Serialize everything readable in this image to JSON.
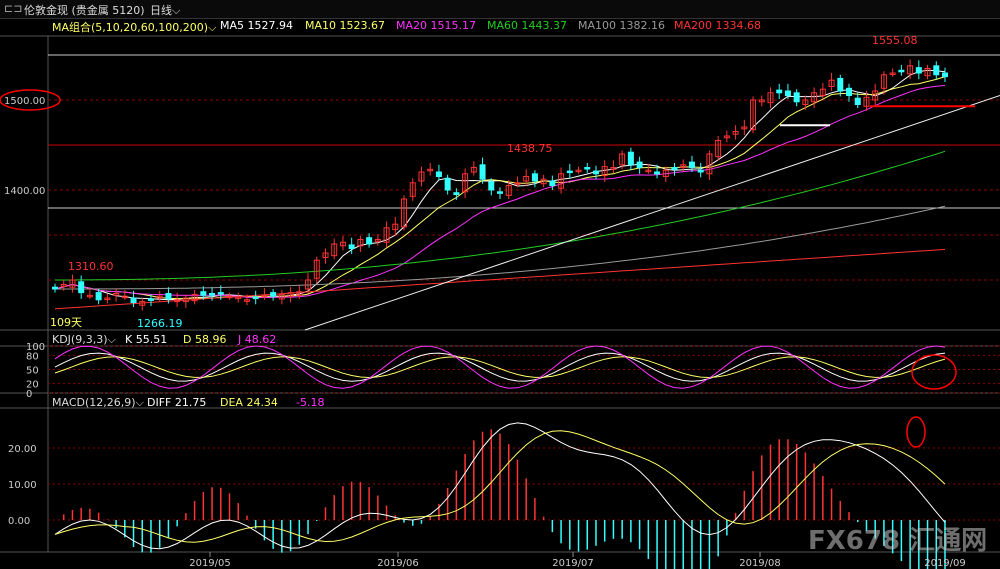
{
  "header": {
    "window_icon": "link-icon",
    "instrument": "伦敦金现 (贵金属 5120)",
    "period": "日线",
    "period_dropdown_icon": "chevron-down-icon"
  },
  "ma_legend": {
    "group": "MA组合(5,10,20,60,100,200)",
    "items": [
      {
        "label": "MA5 1527.94",
        "color": "#ffffff"
      },
      {
        "label": "MA10 1523.67",
        "color": "#ffff66"
      },
      {
        "label": "MA20 1515.17",
        "color": "#ff33ff"
      },
      {
        "label": "MA60 1443.37",
        "color": "#22cc22"
      },
      {
        "label": "MA100 1382.16",
        "color": "#999999"
      },
      {
        "label": "MA200 1334.68",
        "color": "#ff3333"
      }
    ]
  },
  "price_panel": {
    "y_ticks": [
      "1500.00",
      "1400.00"
    ],
    "annotations": {
      "high": "1555.08",
      "mid": "1438.75",
      "early_high": "1310.60",
      "low": "1266.19",
      "days": "109天"
    }
  },
  "kdj_legend": {
    "title": "KDJ(9,3,3)",
    "k": "K 55.51",
    "d": "D 58.96",
    "j": "J 48.62",
    "y_ticks": [
      "100",
      "80",
      "50",
      "20",
      "0"
    ]
  },
  "macd_legend": {
    "title": "MACD(12,26,9)",
    "diff": "DIFF 21.75",
    "dea": "DEA 24.34",
    "macd": "-5.18",
    "y_ticks": [
      "20.00",
      "10.00",
      "0.00"
    ]
  },
  "x_axis": {
    "labels": [
      "2019/05",
      "2019/06",
      "2019/07",
      "2019/08",
      "2019/09"
    ]
  },
  "watermark": "FX678 汇通网",
  "colors": {
    "up": "#ff3333",
    "down": "#33ffff",
    "ma5": "#ffffff",
    "ma10": "#ffff66",
    "ma20": "#ff33ff",
    "ma60": "#22cc22",
    "ma100": "#999999",
    "ma200": "#ff3333",
    "grid": "#8b0000",
    "highlight": "#ff0000"
  },
  "chart_data": [
    {
      "type": "candlestick",
      "x": [
        "2019/05",
        "2019/06",
        "2019/07",
        "2019/08",
        "2019/09"
      ],
      "y_ticks": [
        1400,
        1500
      ],
      "points_of_interest": {
        "high": 1555.08,
        "high_mid": 1438.75,
        "early_high": 1310.6,
        "low": 1266.19
      },
      "close_trend": [
        1290,
        1295,
        1300,
        1286,
        1283,
        1278,
        1280,
        1285,
        1282,
        1275,
        1276,
        1278,
        1282,
        1279,
        1278,
        1280,
        1284,
        1283,
        1283,
        1285,
        1282,
        1281,
        1278,
        1280,
        1283,
        1282,
        1284,
        1286,
        1287,
        1300,
        1322,
        1330,
        1340,
        1342,
        1335,
        1345,
        1340,
        1345,
        1358,
        1362,
        1390,
        1408,
        1420,
        1423,
        1415,
        1400,
        1395,
        1418,
        1425,
        1412,
        1400,
        1397,
        1405,
        1408,
        1415,
        1410,
        1412,
        1405,
        1418,
        1420,
        1422,
        1424,
        1418,
        1426,
        1425,
        1440,
        1428,
        1425,
        1422,
        1418,
        1422,
        1423,
        1428,
        1425,
        1420,
        1440,
        1455,
        1460,
        1465,
        1470,
        1500,
        1500,
        1508,
        1508,
        1505,
        1498,
        1500,
        1508,
        1512,
        1522,
        1510,
        1505,
        1495,
        1503,
        1510,
        1528,
        1530,
        1532,
        1538,
        1530,
        1535,
        1528,
        1526
      ],
      "series": [
        {
          "name": "MA5",
          "last": 1527.94
        },
        {
          "name": "MA10",
          "last": 1523.67
        },
        {
          "name": "MA20",
          "last": 1515.17
        },
        {
          "name": "MA60",
          "last": 1443.37
        },
        {
          "name": "MA100",
          "last": 1382.16
        },
        {
          "name": "MA200",
          "last": 1334.68
        }
      ]
    },
    {
      "type": "line",
      "title": "KDJ(9,3,3)",
      "ylim": [
        0,
        100
      ],
      "series": [
        {
          "name": "K",
          "last": 55.51
        },
        {
          "name": "D",
          "last": 58.96
        },
        {
          "name": "J",
          "last": 48.62
        }
      ]
    },
    {
      "type": "bar",
      "title": "MACD(12,26,9)",
      "y_ticks": [
        0,
        10,
        20
      ],
      "series": [
        {
          "name": "DIFF",
          "last": 21.75
        },
        {
          "name": "DEA",
          "last": 24.34
        },
        {
          "name": "MACD",
          "last": -5.18
        }
      ]
    }
  ]
}
